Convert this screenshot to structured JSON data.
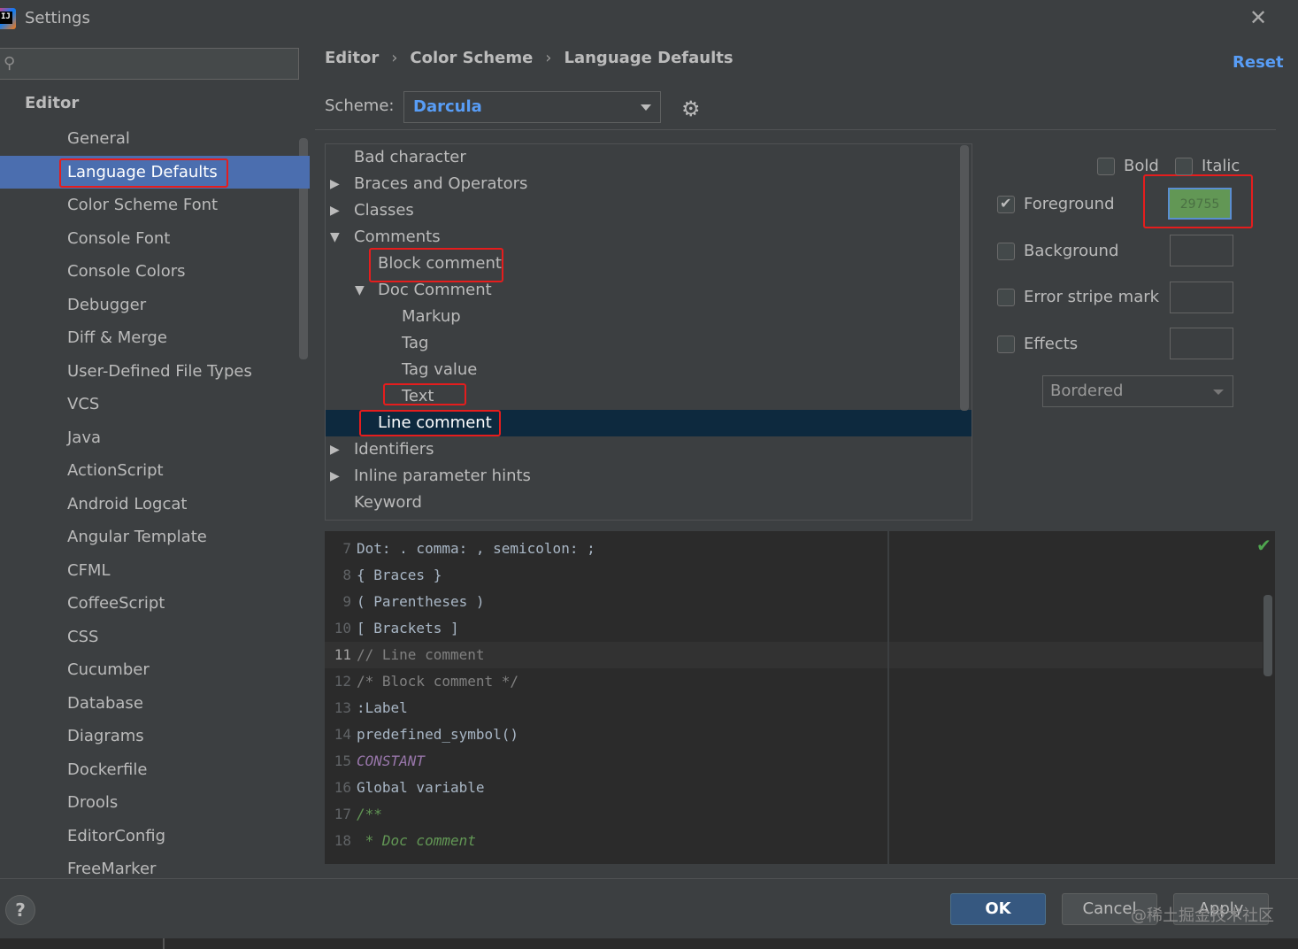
{
  "window": {
    "logo_text": "IJ",
    "title": "Settings",
    "close_glyph": "✕"
  },
  "sidebar": {
    "search_placeholder": "",
    "section": "Editor",
    "items": [
      {
        "label": "General"
      },
      {
        "label": "Language Defaults"
      },
      {
        "label": "Color Scheme Font"
      },
      {
        "label": "Console Font"
      },
      {
        "label": "Console Colors"
      },
      {
        "label": "Debugger"
      },
      {
        "label": "Diff & Merge"
      },
      {
        "label": "User-Defined File Types"
      },
      {
        "label": "VCS"
      },
      {
        "label": "Java"
      },
      {
        "label": "ActionScript"
      },
      {
        "label": "Android Logcat"
      },
      {
        "label": "Angular Template"
      },
      {
        "label": "CFML"
      },
      {
        "label": "CoffeeScript"
      },
      {
        "label": "CSS"
      },
      {
        "label": "Cucumber"
      },
      {
        "label": "Database"
      },
      {
        "label": "Diagrams"
      },
      {
        "label": "Dockerfile"
      },
      {
        "label": "Drools"
      },
      {
        "label": "EditorConfig"
      },
      {
        "label": "FreeMarker"
      }
    ],
    "selected": "Language Defaults"
  },
  "breadcrumb": {
    "items": [
      "Editor",
      "Color Scheme",
      "Language Defaults"
    ],
    "separator": "›"
  },
  "reset_label": "Reset",
  "scheme": {
    "label": "Scheme:",
    "value": "Darcula"
  },
  "tree": {
    "rows": [
      {
        "label": "Bad character",
        "expander": ""
      },
      {
        "label": "Braces and Operators",
        "expander": "▶"
      },
      {
        "label": "Classes",
        "expander": "▶"
      },
      {
        "label": "Comments",
        "expander": "▼"
      },
      {
        "label": "Block comment",
        "expander": ""
      },
      {
        "label": "Doc Comment",
        "expander": "▼"
      },
      {
        "label": "Markup",
        "expander": ""
      },
      {
        "label": "Tag",
        "expander": ""
      },
      {
        "label": "Tag value",
        "expander": ""
      },
      {
        "label": "Text",
        "expander": ""
      },
      {
        "label": "Line comment",
        "expander": ""
      },
      {
        "label": "Identifiers",
        "expander": "▶"
      },
      {
        "label": "Inline parameter hints",
        "expander": "▶"
      },
      {
        "label": "Keyword",
        "expander": ""
      }
    ],
    "selected": "Line comment"
  },
  "attributes": {
    "bold_label": "Bold",
    "bold_checked": false,
    "italic_label": "Italic",
    "italic_checked": false,
    "foreground_label": "Foreground",
    "foreground_checked": true,
    "foreground_value": "29755",
    "foreground_color": "#629755",
    "background_label": "Background",
    "background_checked": false,
    "error_stripe_label": "Error stripe mark",
    "error_stripe_checked": false,
    "effects_label": "Effects",
    "effects_checked": false,
    "effects_type": "Bordered"
  },
  "preview": {
    "lines": [
      {
        "n": "7",
        "text": "Dot: . comma: , semicolon: ;"
      },
      {
        "n": "8",
        "text": "{ Braces }"
      },
      {
        "n": "9",
        "text": "( Parentheses )"
      },
      {
        "n": "10",
        "text": "[ Brackets ]"
      },
      {
        "n": "11",
        "text": "// Line comment"
      },
      {
        "n": "12",
        "text": "/* Block comment */"
      },
      {
        "n": "13",
        "text": ":Label"
      },
      {
        "n": "14",
        "text": "predefined_symbol()"
      },
      {
        "n": "15",
        "text": "CONSTANT"
      },
      {
        "n": "16",
        "text": "Global variable"
      },
      {
        "n": "17",
        "text": "/**"
      },
      {
        "n": "18",
        "text": " * Doc comment"
      }
    ],
    "current_line": "11",
    "status_icon": "check-icon"
  },
  "buttons": {
    "help": "?",
    "ok": "OK",
    "cancel": "Cancel",
    "apply": "Apply"
  },
  "watermark": "@稀土掘金技术社区",
  "colors": {
    "selection": "#4b6eaf",
    "tree_selection": "#0d293e",
    "accent_link": "#589df6",
    "annotation_red": "#e51d1d",
    "ok_button": "#365880"
  }
}
